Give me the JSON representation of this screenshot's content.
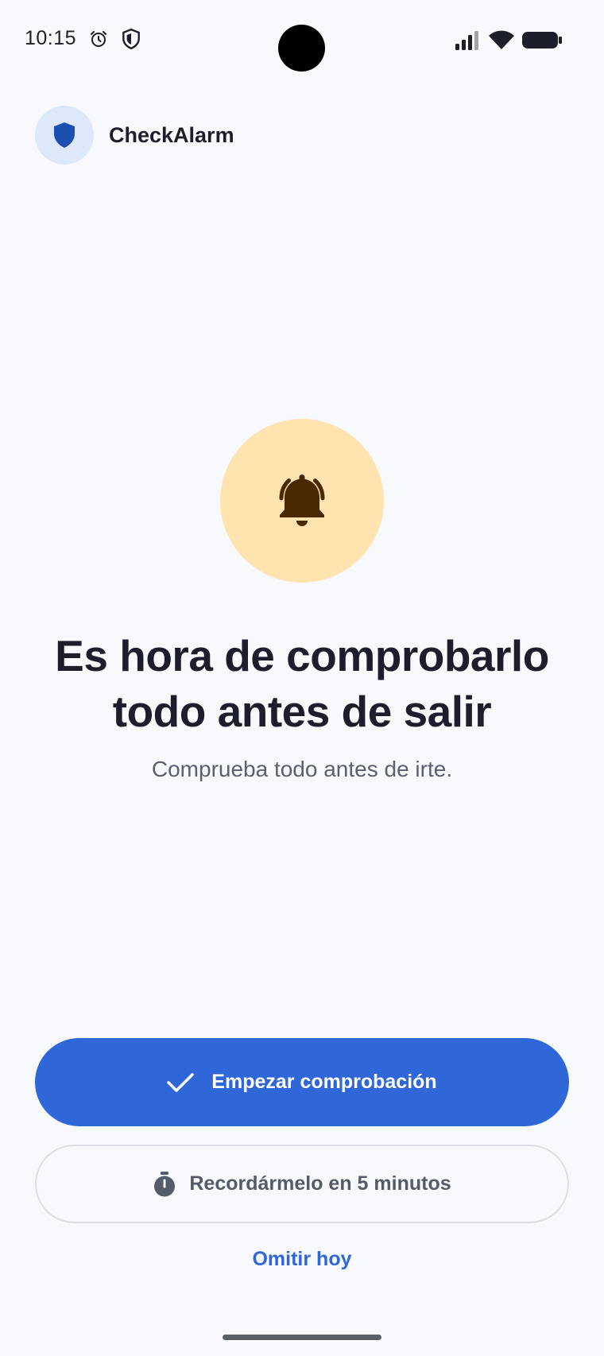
{
  "status_bar": {
    "time": "10:15",
    "icons": [
      "alarm-clock-icon",
      "shield-icon",
      "signal-icon",
      "wifi-icon",
      "battery-icon"
    ]
  },
  "app": {
    "name": "CheckAlarm",
    "logo_icon": "shield-icon"
  },
  "alert": {
    "icon": "bell-ringing-icon",
    "headline_line1": "Es hora de comprobarlo",
    "headline_line2": "todo antes de salir",
    "subtitle": "Comprueba todo antes de irte."
  },
  "actions": {
    "start_label": "Empezar comprobación",
    "start_icon": "check-icon",
    "snooze_label": "Recordármelo en 5 minutos",
    "snooze_icon": "timer-icon",
    "skip_label": "Omitir hoy"
  },
  "colors": {
    "background": "#f8f9fd",
    "primary": "#2f67d8",
    "bell_bg": "#ffe4b0",
    "bell": "#4a2800",
    "logo_bg": "#dde8fb",
    "logo": "#1c4fb0"
  }
}
